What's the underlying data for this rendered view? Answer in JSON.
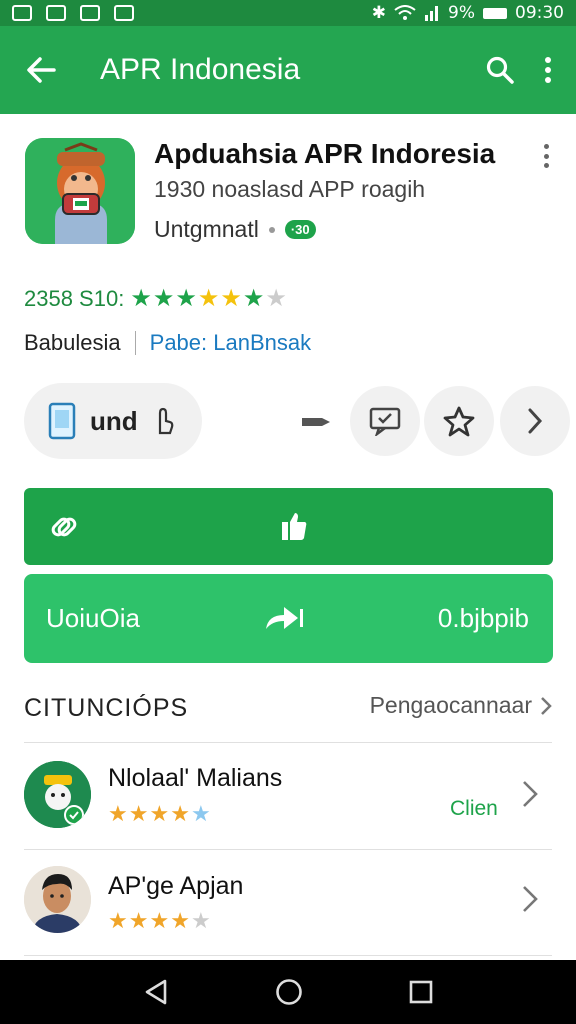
{
  "status_bar": {
    "battery": "9%",
    "time": "09:30"
  },
  "appbar": {
    "title": "APR Indonesia"
  },
  "app": {
    "name": "Apduahsia APR Indoresia",
    "subtitle": "1930 noaslasd APP roagih",
    "developer": "Untgmnatl",
    "badge": "·30",
    "rating_text": "2358 S10:",
    "rating_stars": 4,
    "publisher": "Babulesia",
    "link": "Pabe: LanBnsak"
  },
  "actions": {
    "install_label": "und",
    "primary_button": "",
    "secondary_left": "UoiuOia",
    "secondary_right": "0.bjbpib"
  },
  "section": {
    "title": "CITUNCIÓPS",
    "link": "Pengaocannaar"
  },
  "reviews": [
    {
      "name": "Nlolaal' Malians",
      "stars": 3.5,
      "action": "Clien"
    },
    {
      "name": "AP'ge Apjan",
      "stars": 4,
      "action": ""
    }
  ],
  "colors": {
    "appbar": "#24a651",
    "status_bar": "#1e8a3f",
    "accent": "#1ea34a",
    "secondary": "#2ec26a",
    "star_green": "#1ea34a",
    "star_yellow": "#f4c20d",
    "star_orange": "#f0a52a"
  }
}
